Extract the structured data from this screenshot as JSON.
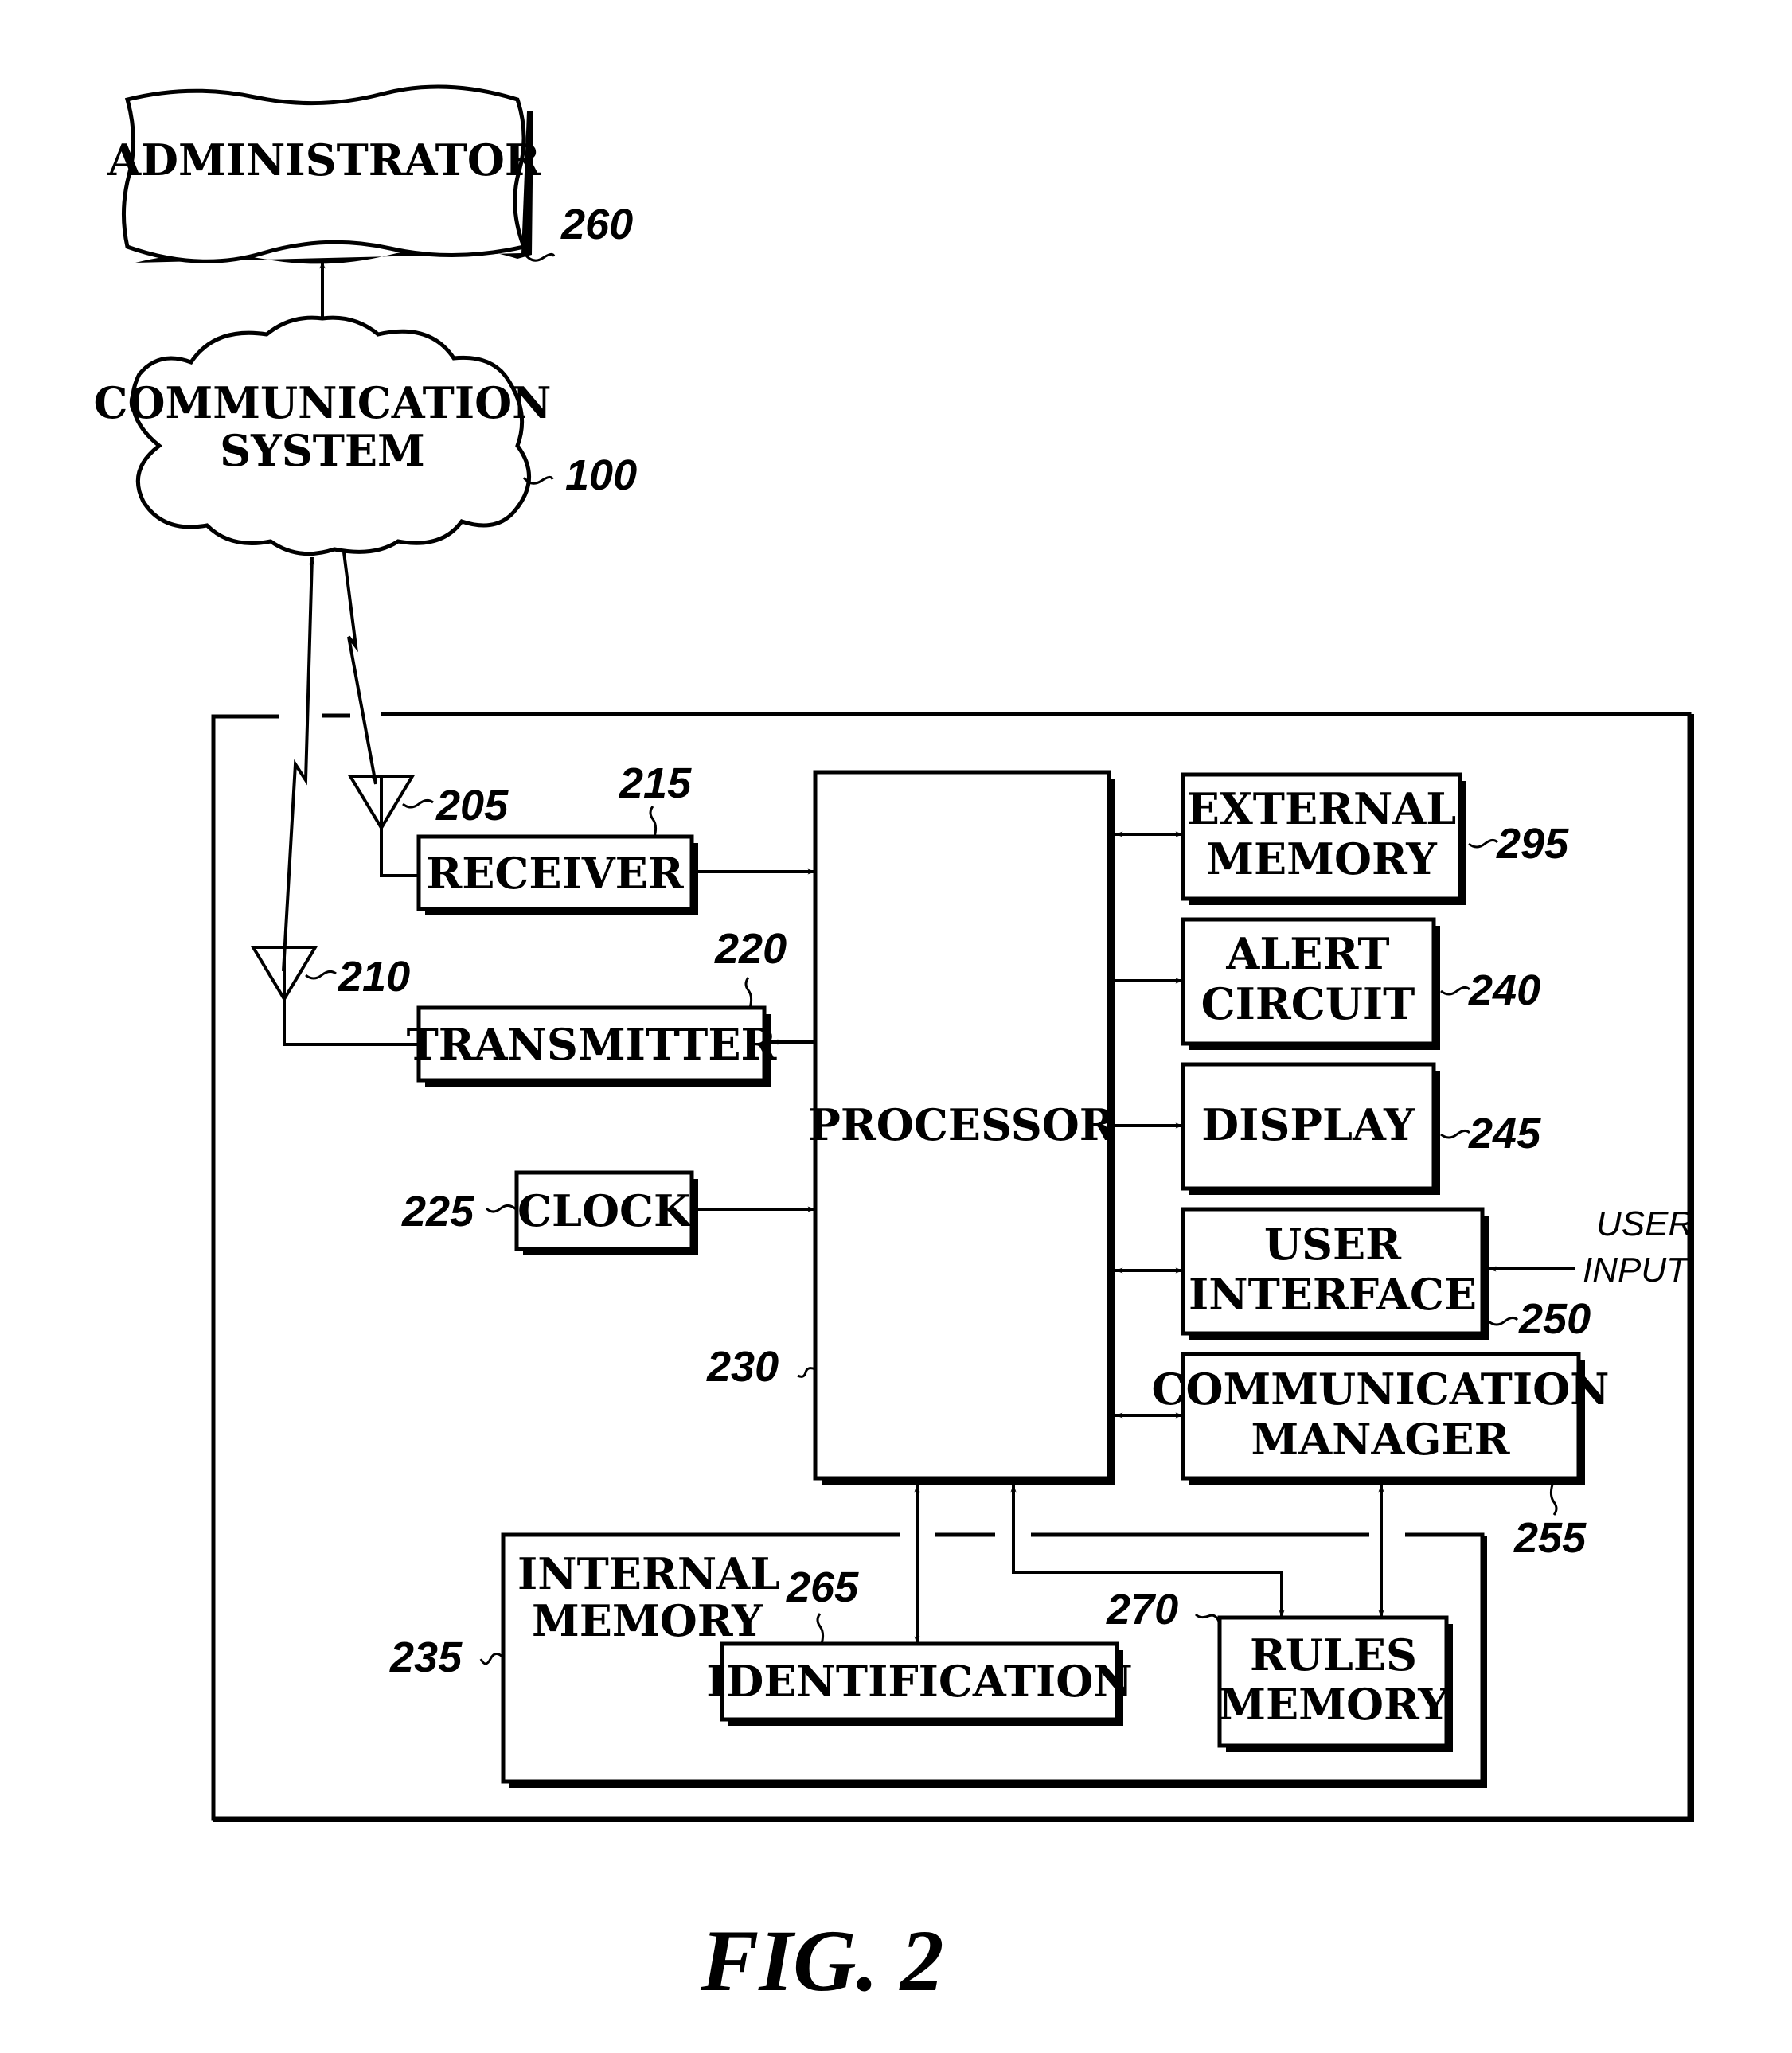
{
  "figure": {
    "caption": "FIG. 2",
    "nodes": {
      "administrator": {
        "label": "ADMINISTRATOR",
        "ref": "260"
      },
      "communication_system": {
        "line1": "COMMUNICATION",
        "line2": "SYSTEM",
        "ref": "100"
      },
      "antenna_rx": {
        "ref": "205"
      },
      "antenna_tx": {
        "ref": "210"
      },
      "receiver": {
        "label": "RECEIVER",
        "ref": "215"
      },
      "transmitter": {
        "label": "TRANSMITTER",
        "ref": "220"
      },
      "clock": {
        "label": "CLOCK",
        "ref": "225"
      },
      "processor": {
        "label": "PROCESSOR",
        "ref": "230"
      },
      "external_memory": {
        "line1": "EXTERNAL",
        "line2": "MEMORY",
        "ref": "295"
      },
      "alert_circuit": {
        "line1": "ALERT",
        "line2": "CIRCUIT",
        "ref": "240"
      },
      "display": {
        "label": "DISPLAY",
        "ref": "245"
      },
      "user_interface": {
        "line1": "USER",
        "line2": "INTERFACE",
        "ref": "250",
        "input_line1": "USER",
        "input_line2": "INPUT"
      },
      "communication_manager": {
        "line1": "COMMUNICATION",
        "line2": "MANAGER",
        "ref": "255"
      },
      "internal_memory": {
        "line1": "INTERNAL",
        "line2": "MEMORY",
        "ref": "235"
      },
      "identification": {
        "label": "IDENTIFICATION",
        "ref": "265"
      },
      "rules_memory": {
        "line1": "RULES",
        "line2": "MEMORY",
        "ref": "270"
      }
    }
  }
}
